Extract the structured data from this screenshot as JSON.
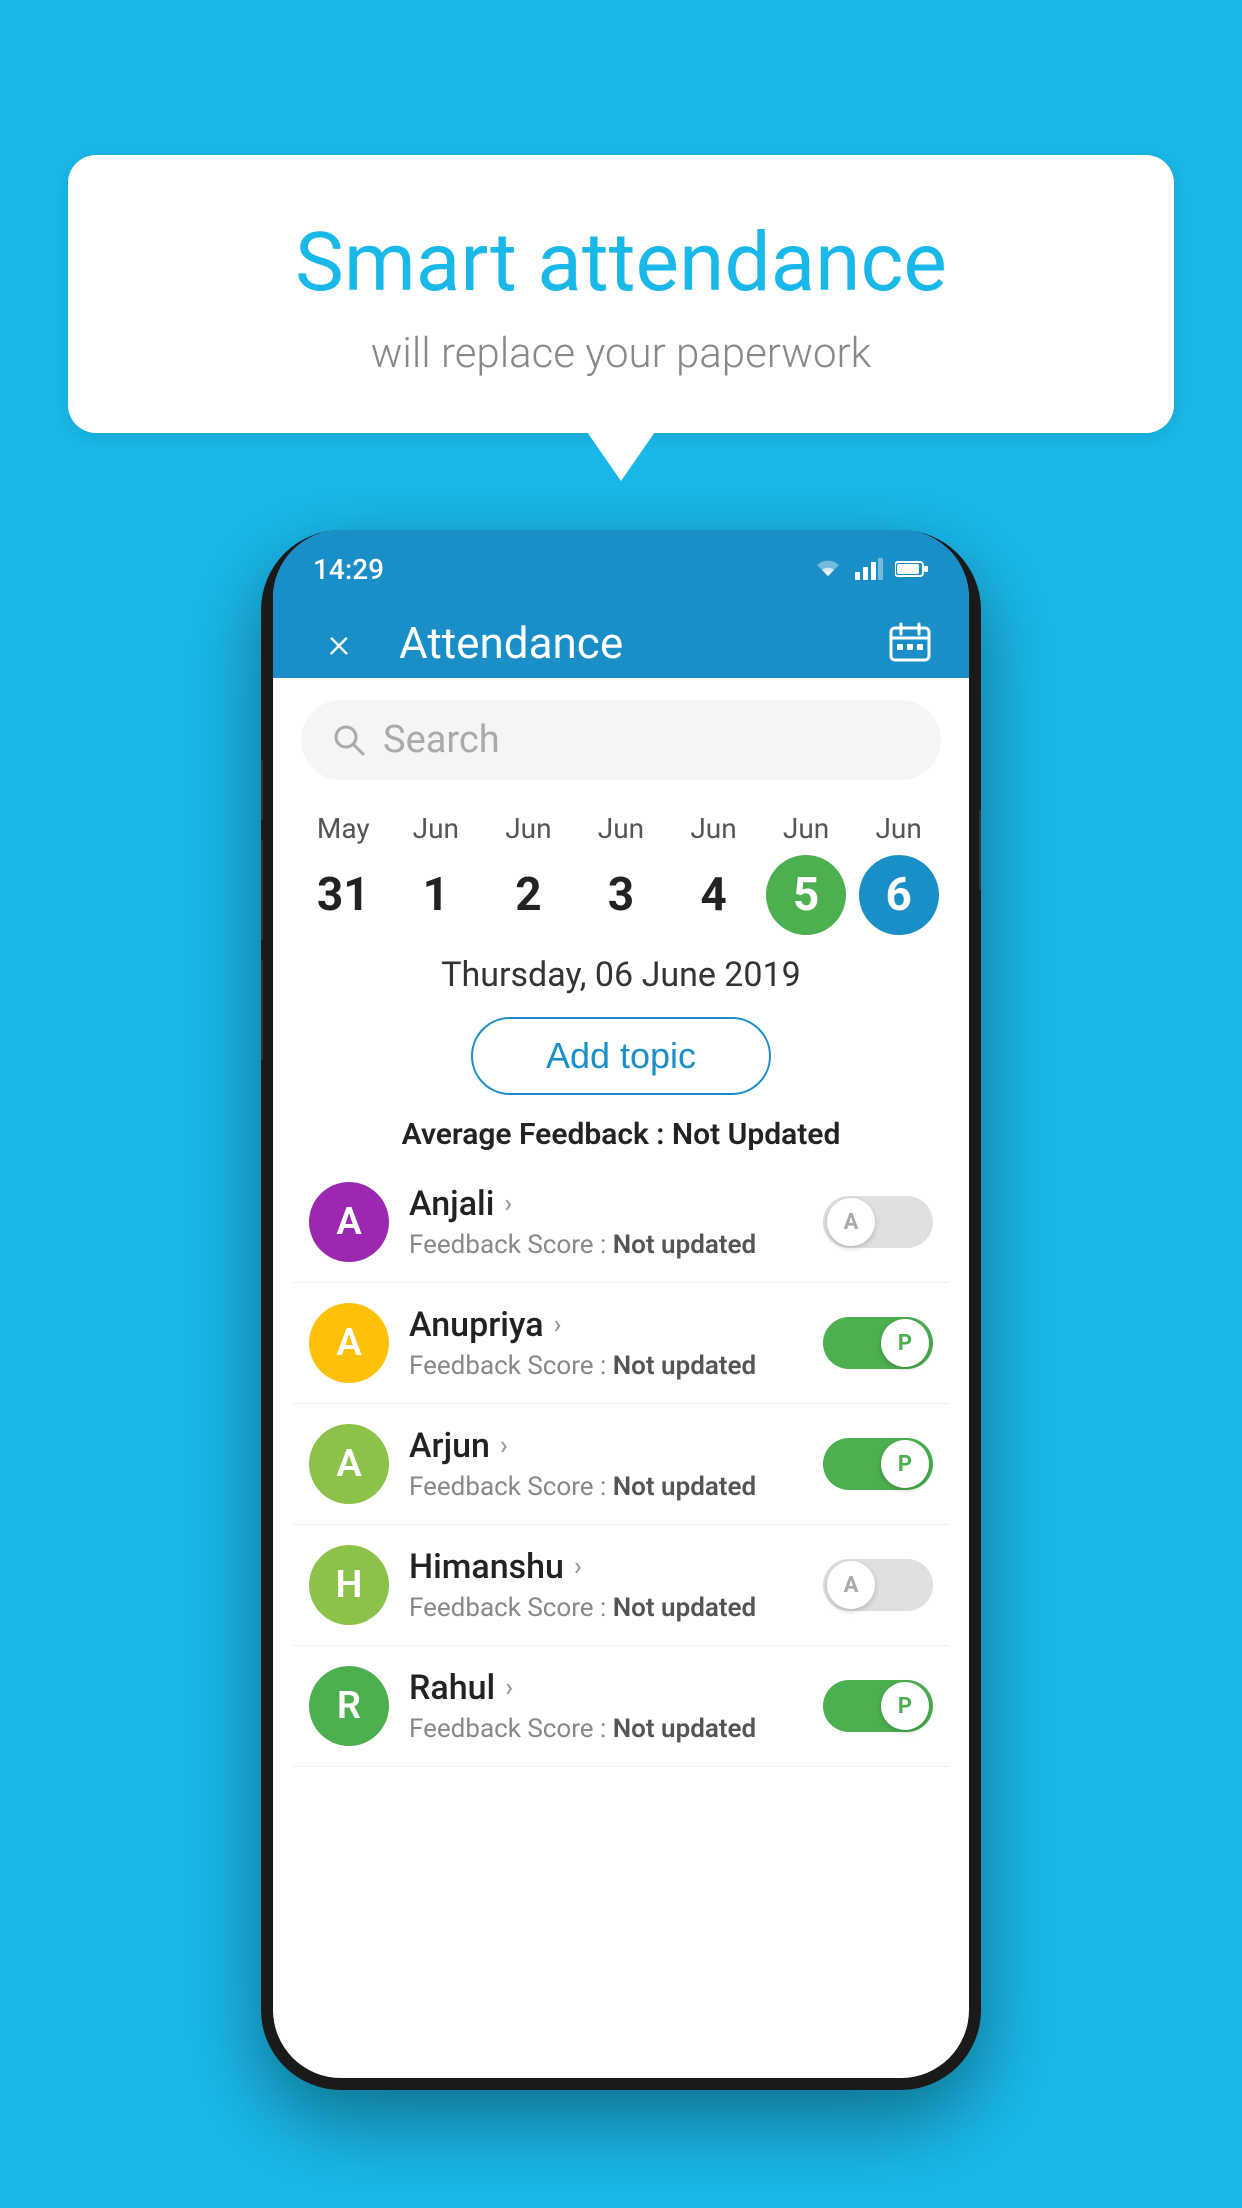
{
  "background_color": "#1ab8e8",
  "speech_bubble": {
    "title": "Smart attendance",
    "subtitle": "will replace your paperwork"
  },
  "status_bar": {
    "time": "14:29",
    "wifi": "wifi",
    "signal": "signal",
    "battery": "battery"
  },
  "app_header": {
    "title": "Attendance",
    "close_label": "×",
    "calendar_icon": "calendar-icon"
  },
  "search": {
    "placeholder": "Search"
  },
  "calendar": {
    "dates": [
      {
        "month": "May",
        "day": "31",
        "state": "normal"
      },
      {
        "month": "Jun",
        "day": "1",
        "state": "normal"
      },
      {
        "month": "Jun",
        "day": "2",
        "state": "normal"
      },
      {
        "month": "Jun",
        "day": "3",
        "state": "normal"
      },
      {
        "month": "Jun",
        "day": "4",
        "state": "normal"
      },
      {
        "month": "Jun",
        "day": "5",
        "state": "today"
      },
      {
        "month": "Jun",
        "day": "6",
        "state": "selected"
      }
    ]
  },
  "selected_date_label": "Thursday, 06 June 2019",
  "add_topic_button": "Add topic",
  "average_feedback": {
    "label": "Average Feedback :",
    "value": "Not Updated"
  },
  "students": [
    {
      "name": "Anjali",
      "avatar_letter": "A",
      "avatar_color": "#9c27b0",
      "feedback_label": "Feedback Score :",
      "feedback_value": "Not updated",
      "toggle": "off",
      "toggle_label": "A"
    },
    {
      "name": "Anupriya",
      "avatar_letter": "A",
      "avatar_color": "#ffc107",
      "feedback_label": "Feedback Score :",
      "feedback_value": "Not updated",
      "toggle": "on",
      "toggle_label": "P"
    },
    {
      "name": "Arjun",
      "avatar_letter": "A",
      "avatar_color": "#8bc34a",
      "feedback_label": "Feedback Score :",
      "feedback_value": "Not updated",
      "toggle": "on",
      "toggle_label": "P"
    },
    {
      "name": "Himanshu",
      "avatar_letter": "H",
      "avatar_color": "#8bc34a",
      "feedback_label": "Feedback Score :",
      "feedback_value": "Not updated",
      "toggle": "off",
      "toggle_label": "A"
    },
    {
      "name": "Rahul",
      "avatar_letter": "R",
      "avatar_color": "#4caf50",
      "feedback_label": "Feedback Score :",
      "feedback_value": "Not updated",
      "toggle": "on",
      "toggle_label": "P"
    }
  ]
}
